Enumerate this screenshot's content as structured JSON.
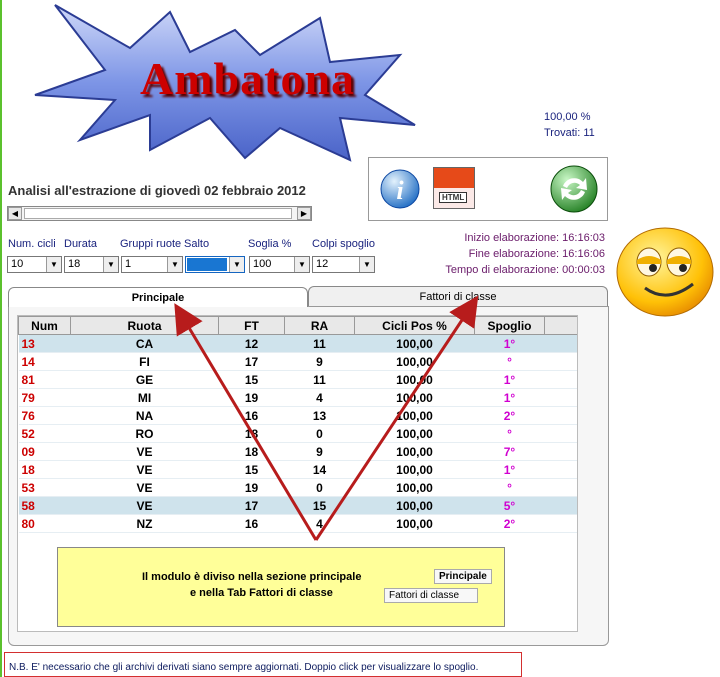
{
  "logo": {
    "text": "Ambatona"
  },
  "stats": {
    "percent": "100,00 %",
    "found": "Trovati: 11"
  },
  "analysis_title": "Analisi all'estrazione di giovedì 02 febbraio 2012",
  "times": {
    "start": "Inizio elaborazione: 16:16:03",
    "end": "Fine elaborazione: 16:16:06",
    "elapsed": "Tempo di elaborazione: 00:00:03"
  },
  "icons": {
    "info": "info-icon",
    "html": "html-export-icon",
    "refresh": "refresh-icon",
    "html_label": "HTML"
  },
  "controls": {
    "labels": {
      "cicli": "Num. cicli",
      "durata": "Durata",
      "gruppi": "Gruppi ruote",
      "salto": "Salto",
      "soglia": "Soglia %",
      "colpi": "Colpi spoglio"
    },
    "values": {
      "cicli": "10",
      "durata": "18",
      "gruppi": "1",
      "salto": "1",
      "soglia": "100",
      "colpi": "12"
    }
  },
  "tabs": {
    "principale": "Principale",
    "fattori": "Fattori di classe"
  },
  "table": {
    "headers": [
      "Num",
      "Ruota",
      "FT",
      "RA",
      "Cicli Pos %",
      "Spoglio"
    ],
    "rows": [
      {
        "num": "13",
        "ruota": "CA",
        "ft": "12",
        "ra": "11",
        "cicli": "100,00",
        "spoglio": "1°",
        "hl": true
      },
      {
        "num": "14",
        "ruota": "FI",
        "ft": "17",
        "ra": "9",
        "cicli": "100,00",
        "spoglio": "°",
        "hl": false
      },
      {
        "num": "81",
        "ruota": "GE",
        "ft": "15",
        "ra": "11",
        "cicli": "100,00",
        "spoglio": "1°",
        "hl": false
      },
      {
        "num": "79",
        "ruota": "MI",
        "ft": "19",
        "ra": "4",
        "cicli": "100,00",
        "spoglio": "1°",
        "hl": false
      },
      {
        "num": "76",
        "ruota": "NA",
        "ft": "16",
        "ra": "13",
        "cicli": "100,00",
        "spoglio": "2°",
        "hl": false
      },
      {
        "num": "52",
        "ruota": "RO",
        "ft": "18",
        "ra": "0",
        "cicli": "100,00",
        "spoglio": "°",
        "hl": false
      },
      {
        "num": "09",
        "ruota": "VE",
        "ft": "18",
        "ra": "9",
        "cicli": "100,00",
        "spoglio": "7°",
        "hl": false
      },
      {
        "num": "18",
        "ruota": "VE",
        "ft": "15",
        "ra": "14",
        "cicli": "100,00",
        "spoglio": "1°",
        "hl": false
      },
      {
        "num": "53",
        "ruota": "VE",
        "ft": "19",
        "ra": "0",
        "cicli": "100,00",
        "spoglio": "°",
        "hl": false
      },
      {
        "num": "58",
        "ruota": "VE",
        "ft": "17",
        "ra": "15",
        "cicli": "100,00",
        "spoglio": "5°",
        "hl": true
      },
      {
        "num": "80",
        "ruota": "NZ",
        "ft": "16",
        "ra": "4",
        "cicli": "100,00",
        "spoglio": "2°",
        "hl": false
      }
    ]
  },
  "note": {
    "line1": "Il modulo è diviso nella sezione principale",
    "line2": "e nella Tab Fattori di classe",
    "btn1": "Principale",
    "btn2": "Fattori di classe"
  },
  "footer": "N.B. E' necessario che gli archivi derivati siano sempre aggiornati. Doppio click per visualizzare lo spoglio."
}
